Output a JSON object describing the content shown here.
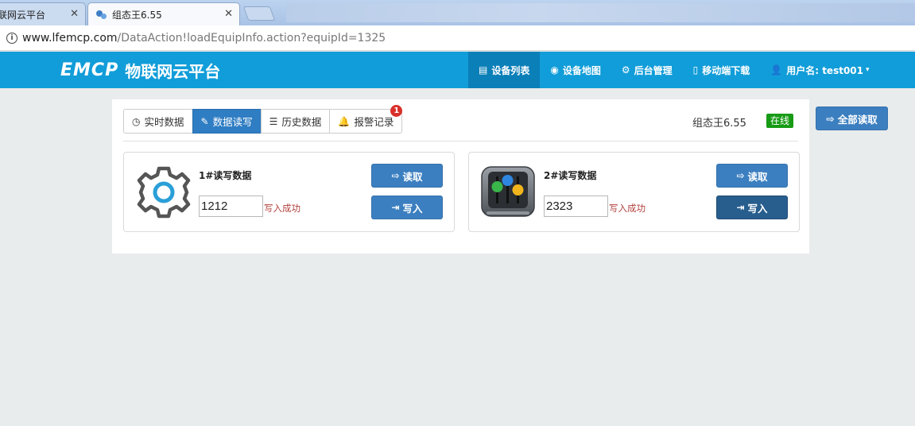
{
  "browser": {
    "tabs": [
      {
        "title": "联网云平台"
      },
      {
        "title": "组态王6.55"
      }
    ],
    "url_host": "www.lfemcp.com",
    "url_path": "/DataAction!loadEquipInfo.action?equipId=1325"
  },
  "navbar": {
    "logo": "EMCP",
    "brand_name": "物联网云平台",
    "items": [
      {
        "label": "设备列表",
        "icon": "list-icon"
      },
      {
        "label": "设备地图",
        "icon": "globe-icon"
      },
      {
        "label": "后台管理",
        "icon": "gears-icon"
      },
      {
        "label": "移动端下载",
        "icon": "mobile-icon"
      },
      {
        "label": "用户名: test001",
        "icon": "user-icon"
      }
    ]
  },
  "subtabs": [
    {
      "label": "实时数据",
      "icon": "clock-icon"
    },
    {
      "label": "数据读写",
      "icon": "pencil-icon"
    },
    {
      "label": "历史数据",
      "icon": "list-icon"
    },
    {
      "label": "报警记录",
      "icon": "bell-icon",
      "badge": "1"
    }
  ],
  "device": {
    "name": "组态王6.55",
    "status": "在线"
  },
  "read_all_label": "全部读取",
  "cards": [
    {
      "title": "1#读写数据",
      "value": "1212",
      "result": "写入成功",
      "read_label": "读取",
      "write_label": "写入",
      "icon": "gear-icon"
    },
    {
      "title": "2#读写数据",
      "value": "2323",
      "result": "写入成功",
      "read_label": "读取",
      "write_label": "写入",
      "icon": "mixer-icon"
    }
  ],
  "colors": {
    "navbar": "#119dd9",
    "navbar_active": "#0b7fb8",
    "button": "#3c7fc0",
    "status_online": "#179b16",
    "success_text": "#b2423d"
  }
}
